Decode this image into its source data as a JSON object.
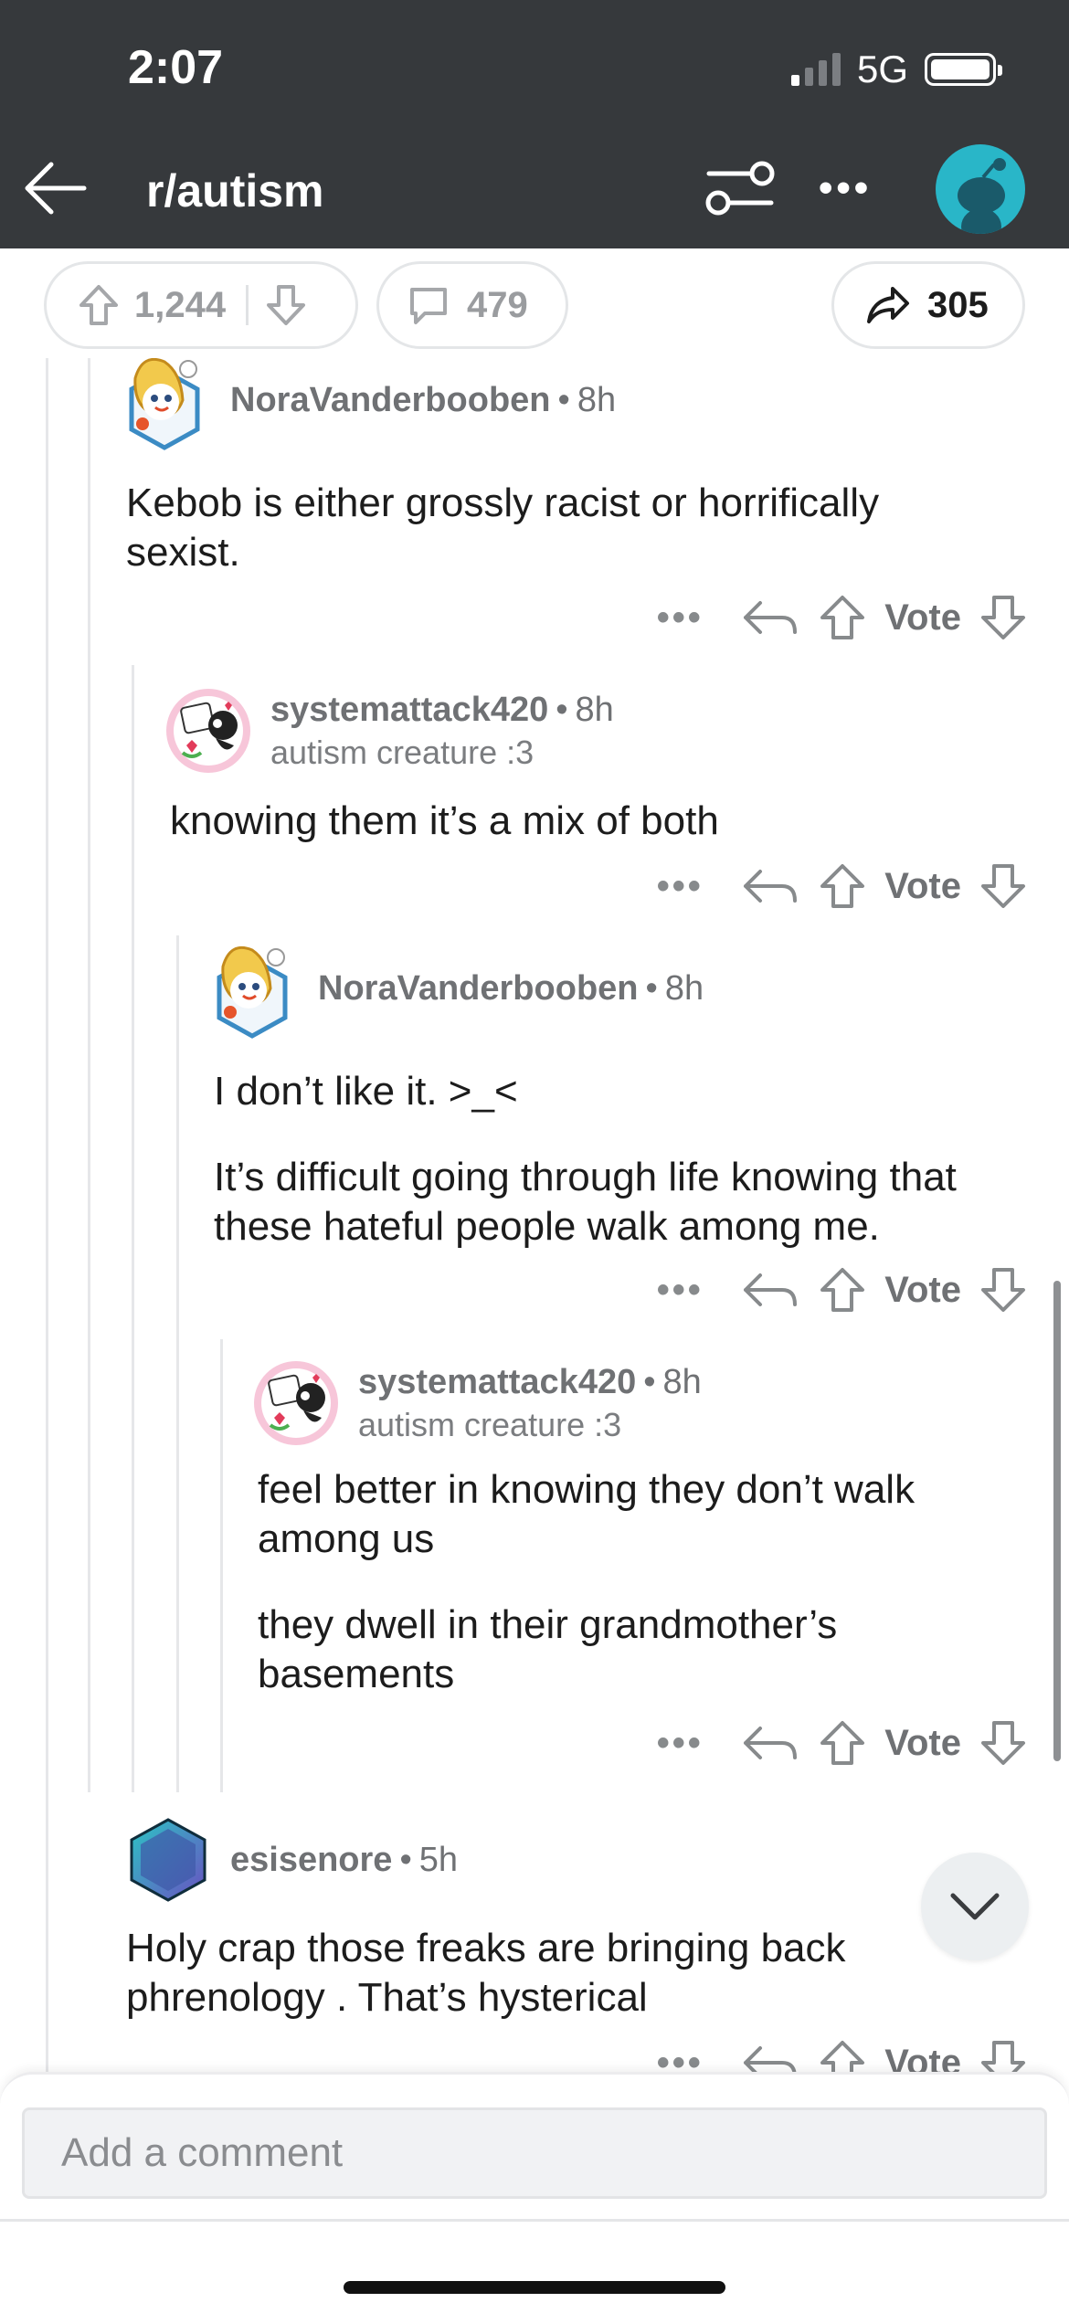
{
  "status": {
    "time": "2:07",
    "network": "5G"
  },
  "header": {
    "subreddit": "r/autism"
  },
  "actions": {
    "upvotes": "1,244",
    "comments": "479",
    "shares": "305"
  },
  "comments": [
    {
      "user": "NoraVanderbooben",
      "time": "8h",
      "flair": "",
      "body": [
        "Kebob is either grossly racist or horrifically sexist."
      ]
    },
    {
      "user": "systemattack420",
      "time": "8h",
      "flair": "autism creature :3",
      "body": [
        "knowing them it’s a mix of both"
      ]
    },
    {
      "user": "NoraVanderbooben",
      "time": "8h",
      "flair": "",
      "body": [
        "I don’t like it. >_<",
        "It’s difficult going through life knowing that these hateful people walk among me."
      ]
    },
    {
      "user": "systemattack420",
      "time": "8h",
      "flair": "autism creature :3",
      "body": [
        "feel better in knowing they don’t walk among us",
        "they dwell in their grandmother’s basements"
      ]
    },
    {
      "user": "esisenore",
      "time": "5h",
      "flair": "",
      "body": [
        "Holy crap those freaks are bringing back phrenology . That’s hysterical"
      ]
    }
  ],
  "labels": {
    "vote": "Vote",
    "separator": "•",
    "more": "•••"
  },
  "composer": {
    "placeholder": "Add a comment"
  },
  "colors": {
    "header_bg": "#36393c",
    "avatar_teal": "#29b6c8",
    "meta_gray": "#6f7174"
  }
}
